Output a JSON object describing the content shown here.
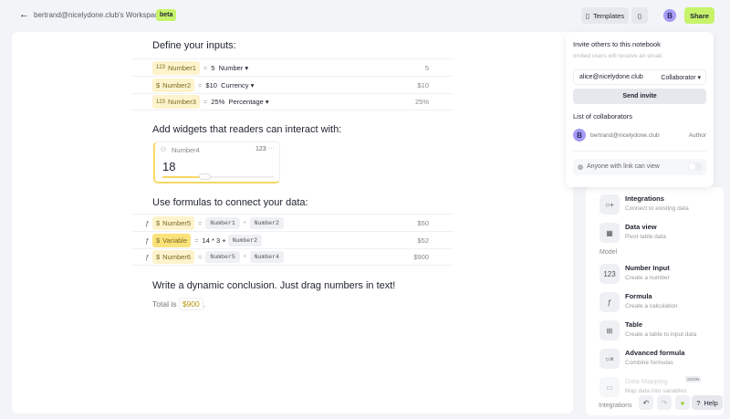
{
  "header": {
    "title": "bertrand@nicelydone.club's Workspace",
    "badge": "beta",
    "templates": "Templates",
    "avatar": "B",
    "share": "Share"
  },
  "sections": {
    "inputs": "Define your inputs:",
    "widgets": "Add widgets that readers can interact with:",
    "formulas": "Use formulas to connect your data:",
    "conclusion": "Write a dynamic conclusion. Just drag numbers in text!"
  },
  "inputs": [
    {
      "icon": "123",
      "name": "Number1",
      "value": "5",
      "type": "Number",
      "result": "5"
    },
    {
      "icon": "$",
      "name": "Number2",
      "value": "$10",
      "type": "Currency",
      "result": "$10"
    },
    {
      "icon": "123",
      "name": "Number3",
      "value": "25%",
      "type": "Percentage",
      "result": "25%"
    }
  ],
  "widget": {
    "name": "Number4",
    "type": "123",
    "more": "···",
    "value": "18",
    "slider_fraction": 0.38
  },
  "formulas": [
    {
      "name": "Number5",
      "a": "Number1",
      "op": "*",
      "b": "Number2",
      "result": "$50"
    },
    {
      "name": "Variable",
      "expr": "14 * 3 +",
      "b": "Number2",
      "result": "$52"
    },
    {
      "name": "Number6",
      "a": "Number5",
      "op": "*",
      "b": "Number4",
      "result": "$900"
    }
  ],
  "conclusion": {
    "prefix": "Total is",
    "value": "$900",
    "suffix": "."
  },
  "invite": {
    "title": "Invite others to this notebook",
    "subtitle": "Invited users will receive an email.",
    "email": "alice@nicelydone.club",
    "role": "Collaborator",
    "send": "Send invite",
    "list_title": "List of collaborators",
    "collab_avatar": "B",
    "collab_email": "bertrand@nicelydone.club",
    "collab_role": "Author",
    "link_label": "Anyone with link can view"
  },
  "sidebar": {
    "items_top": [
      {
        "icon": "○+",
        "title": "Integrations",
        "desc": "Connect to existing data"
      },
      {
        "icon": "▦",
        "title": "Data view",
        "desc": "Pivot table data"
      }
    ],
    "model_label": "Model",
    "items": [
      {
        "icon": "123",
        "title": "Number Input",
        "desc": "Create a number"
      },
      {
        "icon": "ƒ",
        "title": "Formula",
        "desc": "Create a calculation"
      },
      {
        "icon": "⊞",
        "title": "Table",
        "desc": "Create a table to input data"
      },
      {
        "icon": "○×",
        "title": "Advanced formula",
        "desc": "Combine formulas"
      },
      {
        "icon": "▭",
        "title": "Data Mapping",
        "desc": "Map data into variables",
        "badge": "SOON"
      }
    ],
    "integrations_label": "Integrations",
    "help": "Help"
  }
}
